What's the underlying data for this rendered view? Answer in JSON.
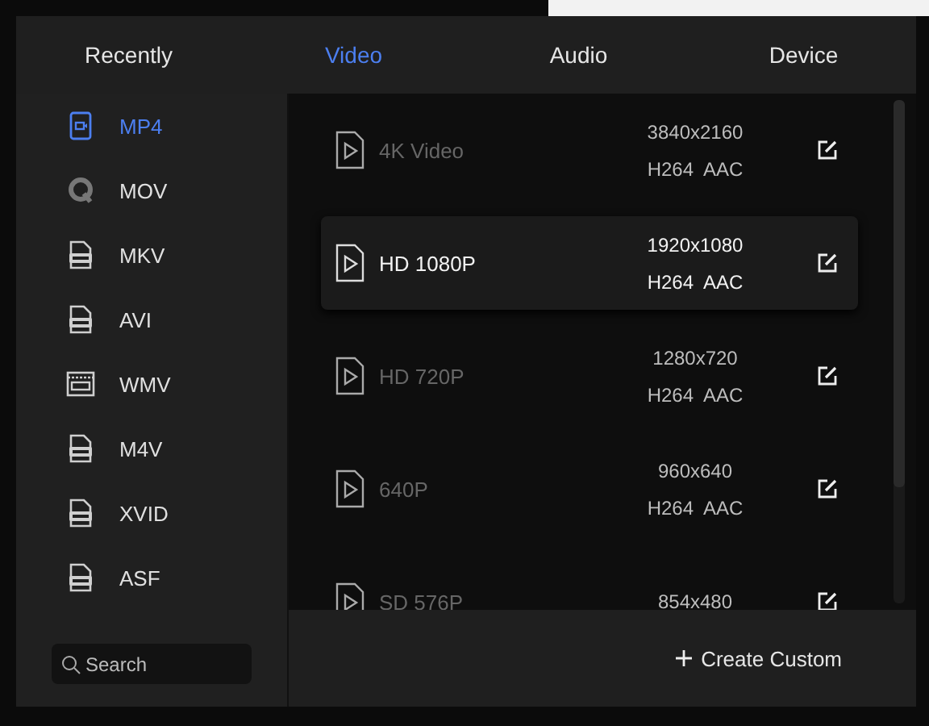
{
  "tabs": [
    {
      "label": "Recently",
      "selected": false
    },
    {
      "label": "Video",
      "selected": true
    },
    {
      "label": "Audio",
      "selected": false
    },
    {
      "label": "Device",
      "selected": false
    }
  ],
  "formats": [
    {
      "label": "MP4",
      "kind": "video",
      "selected": true
    },
    {
      "label": "MOV",
      "kind": "quicktime",
      "selected": false
    },
    {
      "label": "MKV",
      "kind": "file",
      "selected": false
    },
    {
      "label": "AVI",
      "kind": "file",
      "selected": false
    },
    {
      "label": "WMV",
      "kind": "film",
      "selected": false
    },
    {
      "label": "M4V",
      "kind": "file",
      "selected": false
    },
    {
      "label": "XVID",
      "kind": "file",
      "selected": false
    },
    {
      "label": "ASF",
      "kind": "file",
      "selected": false
    }
  ],
  "search": {
    "placeholder": "Search"
  },
  "presets": [
    {
      "name": "4K Video",
      "resolution": "3840x2160",
      "codec": "H264  AAC",
      "selected": false
    },
    {
      "name": "HD 1080P",
      "resolution": "1920x1080",
      "codec": "H264  AAC",
      "selected": true
    },
    {
      "name": "HD 720P",
      "resolution": "1280x720",
      "codec": "H264  AAC",
      "selected": false
    },
    {
      "name": "640P",
      "resolution": "960x640",
      "codec": "H264  AAC",
      "selected": false
    },
    {
      "name": "SD 576P",
      "resolution": "854x480",
      "selected": false
    }
  ],
  "create_button": {
    "label": "Create Custom"
  }
}
